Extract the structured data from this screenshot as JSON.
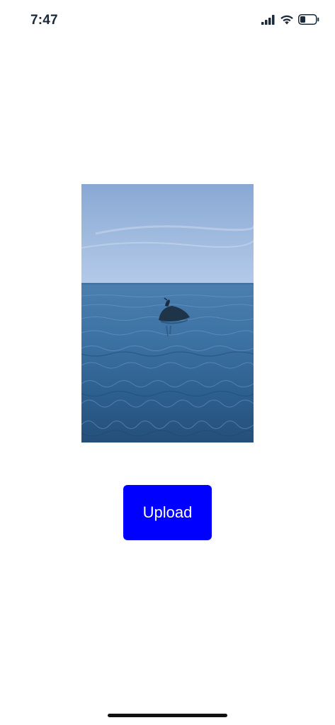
{
  "status_bar": {
    "time": "7:47",
    "icons": [
      "cellular-signal-icon",
      "wifi-icon",
      "battery-icon"
    ]
  },
  "main": {
    "image_subject": "bird-on-rock-in-sea",
    "upload_button_label": "Upload",
    "upload_button_color": "#0000ff"
  }
}
